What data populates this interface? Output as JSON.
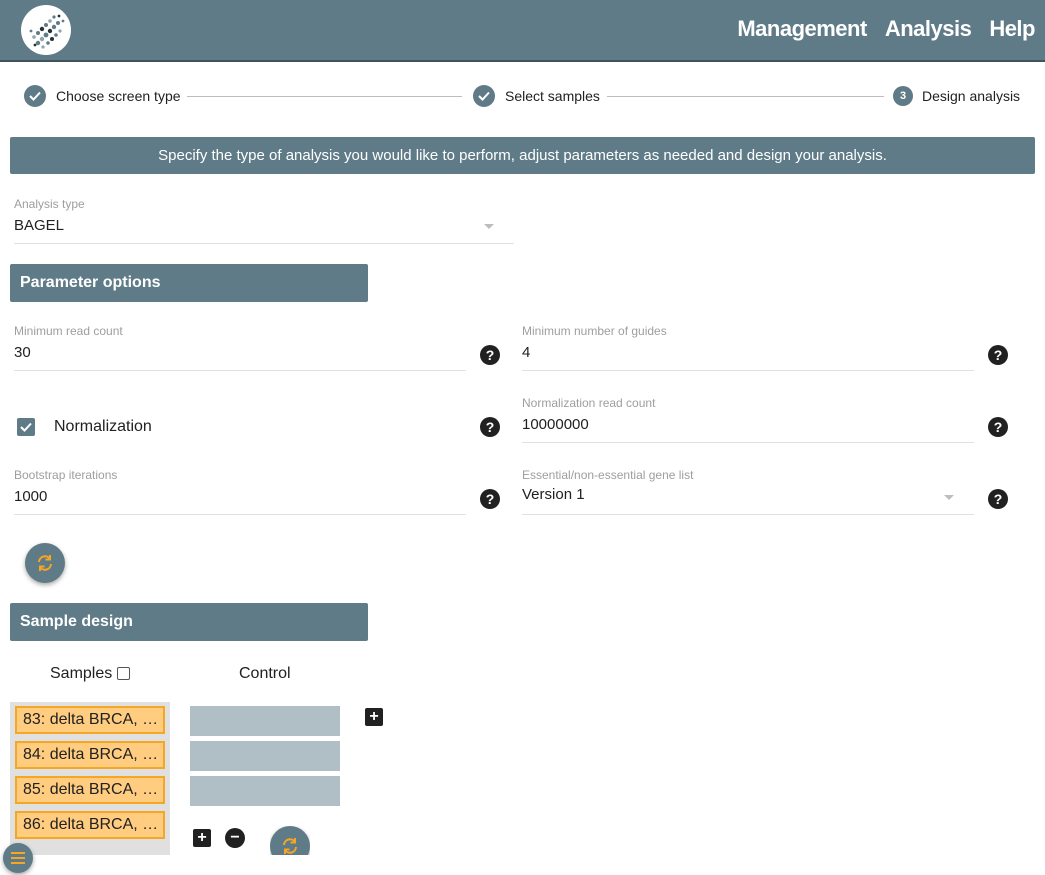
{
  "header": {
    "nav": [
      "Management",
      "Analysis",
      "Help"
    ]
  },
  "stepper": {
    "steps": [
      {
        "label": "Choose screen type",
        "state": "done"
      },
      {
        "label": "Select samples",
        "state": "done"
      },
      {
        "label": "Design analysis",
        "state": "active",
        "number": "3"
      }
    ]
  },
  "banner": "Specify the type of analysis you would like to perform, adjust parameters as needed and design your analysis.",
  "analysis_type": {
    "label": "Analysis type",
    "value": "BAGEL"
  },
  "parameter_section": {
    "title": "Parameter options",
    "min_read_count": {
      "label": "Minimum read count",
      "value": "30"
    },
    "min_guides": {
      "label": "Minimum number of guides",
      "value": "4"
    },
    "normalization": {
      "label": "Normalization",
      "checked": true
    },
    "norm_read_count": {
      "label": "Normalization read count",
      "value": "10000000"
    },
    "bootstrap": {
      "label": "Bootstrap iterations",
      "value": "1000"
    },
    "gene_list": {
      "label": "Essential/non-essential gene list",
      "value": "Version 1"
    },
    "help_glyph": "?"
  },
  "sample_section": {
    "title": "Sample design",
    "samples_header": "Samples",
    "control_header": "Control",
    "samples": [
      "83: delta BRCA, …",
      "84: delta BRCA, …",
      "85: delta BRCA, …",
      "86: delta BRCA, …"
    ],
    "plus_glyph": "+",
    "minus_glyph": "−"
  },
  "colors": {
    "primary": "#5f7b87",
    "accent": "#f5a623",
    "sample_chip": "#ffcc80",
    "control_box": "#b0bec5"
  }
}
